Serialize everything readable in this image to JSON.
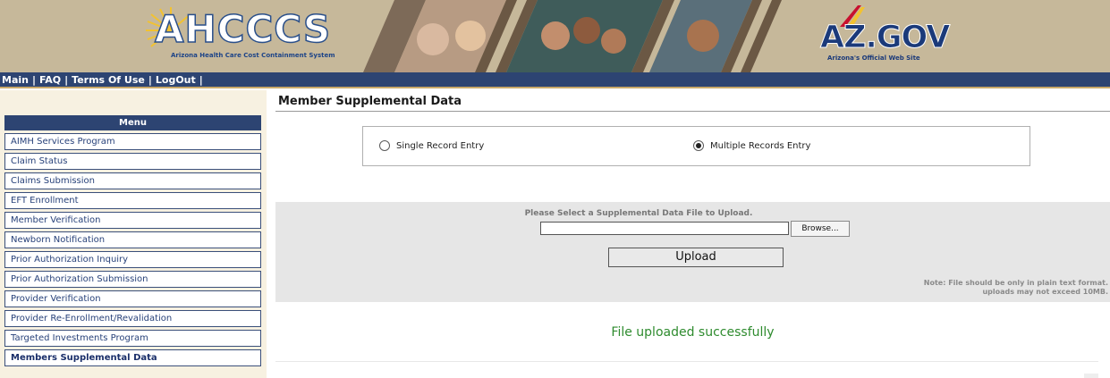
{
  "banner": {
    "logo_text": "AHCCCS",
    "logo_subtitle": "Arizona Health Care Cost Containment System",
    "azgov_text": "AZ.GOV",
    "azgov_subtitle": "Arizona's Official Web Site"
  },
  "topnav": {
    "items": [
      "Main",
      "FAQ",
      "Terms Of Use",
      "LogOut"
    ],
    "separator": "|"
  },
  "sidebar": {
    "menu_title": "Menu",
    "items": [
      {
        "label": "AIMH Services Program"
      },
      {
        "label": "Claim Status"
      },
      {
        "label": "Claims Submission"
      },
      {
        "label": "EFT Enrollment"
      },
      {
        "label": "Member Verification"
      },
      {
        "label": "Newborn Notification"
      },
      {
        "label": "Prior Authorization Inquiry"
      },
      {
        "label": "Prior Authorization Submission"
      },
      {
        "label": "Provider Verification"
      },
      {
        "label": "Provider Re-Enrollment/Revalidation"
      },
      {
        "label": "Targeted Investments Program"
      },
      {
        "label": "Members Supplemental Data"
      }
    ],
    "active_index": 11
  },
  "main": {
    "title": "Member Supplemental Data",
    "entry_mode": {
      "single_label": "Single Record Entry",
      "multiple_label": "Multiple Records Entry",
      "selected": "multiple"
    },
    "upload": {
      "prompt": "Please Select a Supplemental Data File to Upload.",
      "file_value": "",
      "browse_label": "Browse...",
      "upload_label": "Upload",
      "note_line1": "Note: File should be only in plain text format.",
      "note_line2": "uploads may not exceed 10MB."
    },
    "status_message": "File uploaded successfully"
  },
  "colors": {
    "nav_bg": "#2d4472",
    "sidebar_bg": "#f7f1e1",
    "banner_bg": "#c6b89a",
    "success_text": "#2e8b2e",
    "upload_panel_bg": "#e6e6e6"
  }
}
